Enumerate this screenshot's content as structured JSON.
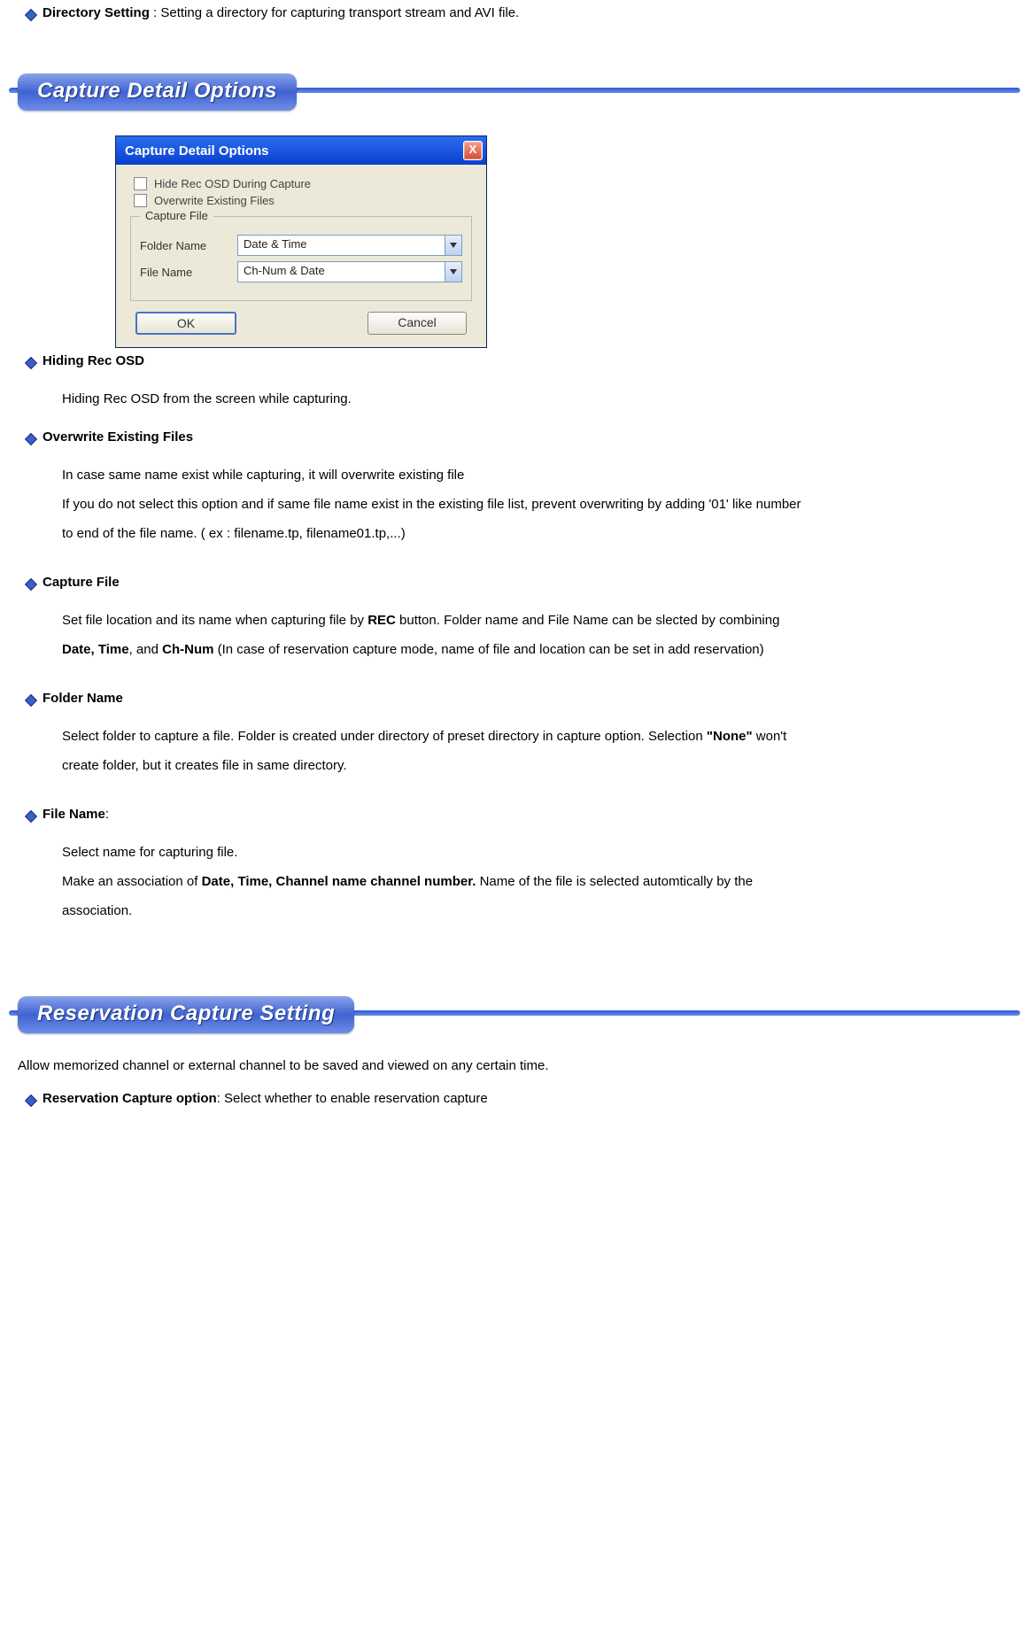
{
  "top_bullet": {
    "title": "Directory Setting",
    "sep": " : ",
    "desc": "Setting a directory for capturing transport stream  and AVI file."
  },
  "section1": {
    "title": "Capture Detail Options"
  },
  "dialog": {
    "title": "Capture Detail Options",
    "close": "X",
    "chk1": "Hide Rec OSD During Capture",
    "chk2": "Overwrite Existing Files",
    "group": "Capture File",
    "folder_label": "Folder Name",
    "folder_value": "Date & Time",
    "file_label": "File Name",
    "file_value": "Ch-Num & Date",
    "ok": "OK",
    "cancel": "Cancel"
  },
  "items": {
    "hiding": {
      "title": "Hiding Rec OSD",
      "desc": "Hiding Rec OSD from   the screen while capturing."
    },
    "overwrite": {
      "title": "Overwrite Existing Files",
      "d1": "In case same name exist while capturing, it will overwrite existing file",
      "d2": "If you do not select this option and if same file name exist in the existing file list, prevent overwriting by adding '01' like number to end of the file name. ( ex : filename.tp, filename01.tp,...)"
    },
    "capturefile": {
      "title": "Capture File",
      "pre": "Set file location and its name when capturing file by ",
      "b1": "REC",
      "mid1": " button. Folder name and File Name can be slected by combining ",
      "b2": "Date, Time",
      "mid2": ", and ",
      "b3": "Ch-Num",
      "post": "   (In case of reservation capture mode, name of file and location can be set in add reservation)"
    },
    "foldername": {
      "title": " Folder Name",
      "pre": "Select folder to capture a file. Folder is created under directory of   preset directory  in capture option. Selection ",
      "b1": "\"None\"",
      "post": " won't create folder, but it creates file in same directory."
    },
    "filename": {
      "title": " File Name",
      "colon": ":",
      "d1": "Select name for capturing file.",
      "pre": "  Make an association of ",
      "b1": "Date, Time, Channel name channel number.",
      "post": " Name of the file is selected automtically by the association."
    }
  },
  "section2": {
    "title": "Reservation Capture Setting"
  },
  "res_intro": "Allow memorized channel or external channel to be saved and viewed on any certain time.",
  "res_bullet": {
    "title": "Reservation Capture option",
    "sep": ": ",
    "desc": "Select whether to enable reservation capture"
  }
}
